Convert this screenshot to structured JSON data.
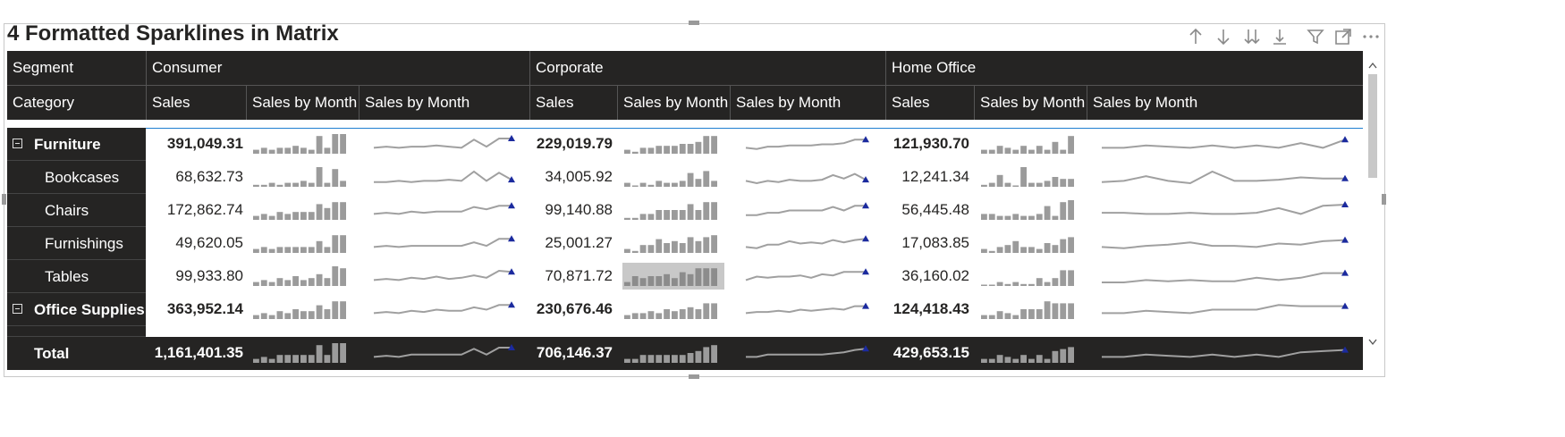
{
  "title": "4 Formatted Sparklines in Matrix",
  "toolbar": [
    {
      "name": "sort-ascending-icon"
    },
    {
      "name": "sort-descending-icon"
    },
    {
      "name": "expand-all-down-icon"
    },
    {
      "name": "drill-down-icon"
    },
    {
      "name": "filter-icon"
    },
    {
      "name": "focus-mode-icon"
    },
    {
      "name": "more-options-icon"
    }
  ],
  "header": {
    "segment_label": "Segment",
    "category_label": "Category",
    "segments": [
      "Consumer",
      "Corporate",
      "Home Office"
    ],
    "measures": [
      "Sales",
      "Sales by Month",
      "Sales by Month"
    ]
  },
  "colors": {
    "header_bg": "#252423",
    "bar": "#9b9b9b",
    "line": "#a0a0a0",
    "marker": "#1b2a9e",
    "highlight": "#c8c8c8"
  },
  "rows": [
    {
      "label": "Furniture",
      "level": 0,
      "bold": true,
      "values": [
        "391,049.31",
        "229,019.79",
        "121,930.70"
      ]
    },
    {
      "label": "Bookcases",
      "level": 1,
      "bold": false,
      "values": [
        "68,632.73",
        "34,005.92",
        "12,241.34"
      ]
    },
    {
      "label": "Chairs",
      "level": 1,
      "bold": false,
      "values": [
        "172,862.74",
        "99,140.88",
        "56,445.48"
      ]
    },
    {
      "label": "Furnishings",
      "level": 1,
      "bold": false,
      "values": [
        "49,620.05",
        "25,001.27",
        "17,083.85"
      ]
    },
    {
      "label": "Tables",
      "level": 1,
      "bold": false,
      "values": [
        "99,933.80",
        "70,871.72",
        "36,160.02"
      ]
    },
    {
      "label": "Office Supplies",
      "level": 0,
      "bold": true,
      "values": [
        "363,952.14",
        "230,676.46",
        "124,418.43"
      ]
    }
  ],
  "total": {
    "label": "Total",
    "values": [
      "1,161,401.35",
      "706,146.37",
      "429,653.15"
    ]
  },
  "sparklines": {
    "Furniture": [
      [
        2,
        3,
        2,
        3,
        3,
        4,
        3,
        2,
        9,
        3,
        10,
        10
      ],
      [
        2,
        1,
        3,
        3,
        4,
        4,
        4,
        5,
        5,
        6,
        9,
        9
      ],
      [
        2,
        2,
        4,
        3,
        2,
        4,
        2,
        4,
        2,
        6,
        2,
        9
      ]
    ],
    "Bookcases": [
      [
        1,
        1,
        2,
        1,
        2,
        2,
        3,
        2,
        10,
        2,
        9,
        3
      ],
      [
        2,
        0,
        2,
        1,
        3,
        2,
        2,
        3,
        7,
        4,
        8,
        3
      ],
      [
        1,
        2,
        6,
        2,
        0,
        10,
        2,
        2,
        3,
        5,
        4,
        4
      ]
    ],
    "Chairs": [
      [
        2,
        3,
        2,
        4,
        3,
        4,
        4,
        4,
        8,
        6,
        9,
        9
      ],
      [
        1,
        1,
        3,
        3,
        5,
        5,
        5,
        5,
        8,
        5,
        9,
        9
      ],
      [
        3,
        3,
        2,
        2,
        3,
        2,
        2,
        3,
        7,
        2,
        9,
        10
      ]
    ],
    "Furnishings": [
      [
        2,
        3,
        2,
        3,
        3,
        3,
        3,
        3,
        6,
        3,
        9,
        9
      ],
      [
        2,
        1,
        4,
        4,
        7,
        5,
        6,
        5,
        8,
        6,
        8,
        9
      ],
      [
        2,
        1,
        3,
        4,
        6,
        3,
        3,
        2,
        5,
        4,
        7,
        8
      ]
    ],
    "Tables": [
      [
        2,
        3,
        2,
        4,
        3,
        5,
        3,
        4,
        6,
        4,
        10,
        9
      ],
      [
        2,
        5,
        4,
        5,
        5,
        6,
        4,
        7,
        6,
        9,
        9,
        9
      ],
      [
        0,
        0,
        2,
        1,
        2,
        1,
        1,
        4,
        2,
        4,
        8,
        8
      ]
    ],
    "Office Supplies": [
      [
        2,
        3,
        2,
        4,
        3,
        5,
        4,
        4,
        7,
        5,
        9,
        9
      ],
      [
        2,
        3,
        3,
        4,
        3,
        5,
        4,
        5,
        6,
        5,
        8,
        8
      ],
      [
        2,
        2,
        4,
        3,
        2,
        5,
        5,
        5,
        9,
        8,
        8,
        8
      ]
    ],
    "Total": [
      [
        2,
        3,
        2,
        4,
        4,
        4,
        4,
        4,
        9,
        4,
        10,
        10
      ],
      [
        2,
        2,
        4,
        4,
        4,
        4,
        4,
        4,
        5,
        6,
        8,
        9
      ],
      [
        2,
        2,
        4,
        3,
        2,
        4,
        2,
        4,
        2,
        6,
        7,
        8
      ]
    ]
  }
}
